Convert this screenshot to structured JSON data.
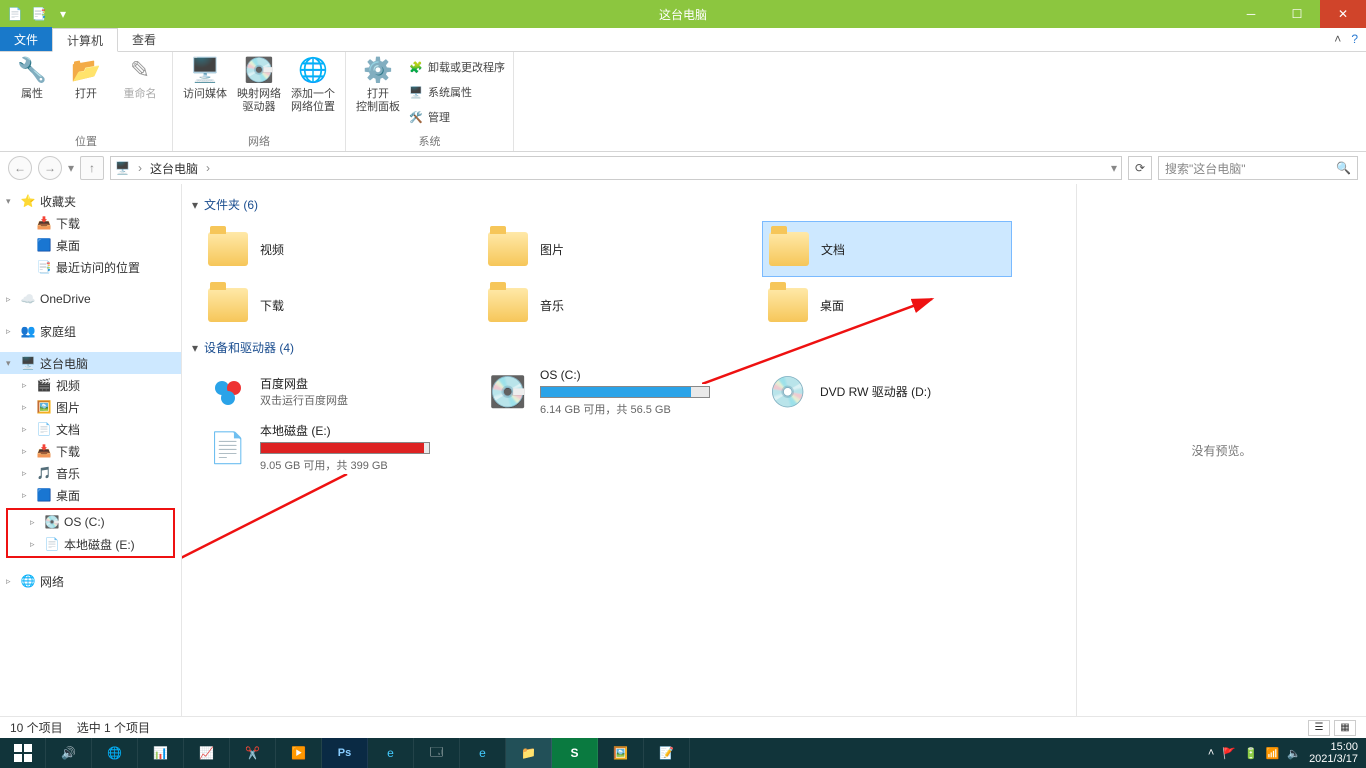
{
  "window": {
    "title": "这台电脑"
  },
  "ribbon_tabs": {
    "file": "文件",
    "computer": "计算机",
    "view": "查看"
  },
  "ribbon": {
    "location": {
      "properties": "属性",
      "open": "打开",
      "rename": "重命名",
      "group": "位置"
    },
    "network": {
      "access_media": "访问媒体",
      "map_drive": "映射网络\n驱动器",
      "add_location": "添加一个\n网络位置",
      "group": "网络"
    },
    "system": {
      "control_panel": "打开\n控制面板",
      "uninstall": "卸载或更改程序",
      "sys_props": "系统属性",
      "manage": "管理",
      "group": "系统"
    }
  },
  "breadcrumb": {
    "root": "这台电脑"
  },
  "search_placeholder": "搜索\"这台电脑\"",
  "tree": {
    "favorites": "收藏夹",
    "downloads": "下载",
    "desktop": "桌面",
    "recent": "最近访问的位置",
    "onedrive": "OneDrive",
    "homegroup": "家庭组",
    "this_pc": "这台电脑",
    "videos": "视频",
    "pictures": "图片",
    "documents": "文档",
    "downloads2": "下载",
    "music": "音乐",
    "desktop2": "桌面",
    "os_c": "OS (C:)",
    "local_e": "本地磁盘 (E:)",
    "network": "网络"
  },
  "groups": {
    "folders": {
      "header": "文件夹 (6)",
      "items": [
        "视频",
        "图片",
        "文档",
        "下载",
        "音乐",
        "桌面"
      ]
    },
    "devices": {
      "header": "设备和驱动器 (4)",
      "baidu": {
        "name": "百度网盘",
        "sub": "双击运行百度网盘"
      },
      "os_c": {
        "name": "OS (C:)",
        "sub": "6.14 GB 可用，共 56.5 GB",
        "fill": 0.89,
        "color": "#2aa3e8"
      },
      "dvd": {
        "name": "DVD RW 驱动器 (D:)"
      },
      "local_e": {
        "name": "本地磁盘 (E:)",
        "sub": "9.05 GB 可用，共 399 GB",
        "fill": 0.97,
        "color": "#d22"
      }
    }
  },
  "preview": {
    "none": "没有预览。"
  },
  "status": {
    "count": "10 个项目",
    "selected": "选中 1 个项目"
  },
  "taskbar": {
    "time": "15:00",
    "date": "2021/3/17"
  }
}
